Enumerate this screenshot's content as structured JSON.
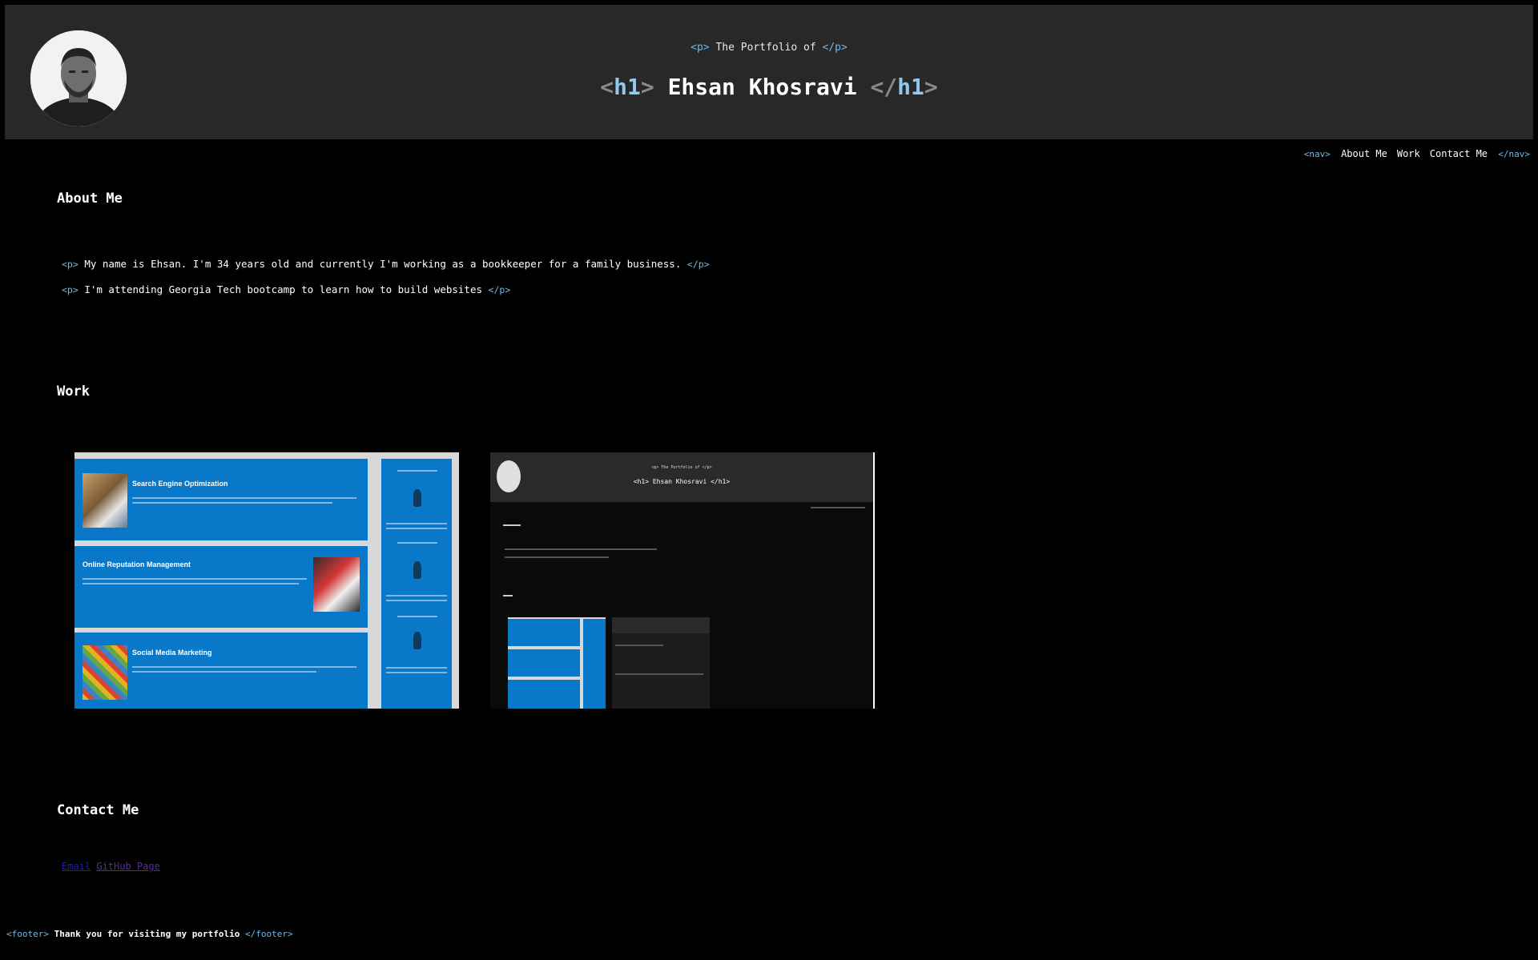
{
  "header": {
    "p_open": "<p>",
    "subtitle": "The Portfolio of",
    "p_close": "</p>",
    "h1_lt": "<",
    "h1_tag": "h1",
    "h1_gt": ">",
    "name": "Ehsan Khosravi",
    "h1_close_lt": "</",
    "h1_close_gt": ">"
  },
  "nav": {
    "open_tag": "<nav>",
    "items": [
      "About Me",
      "Work",
      "Contact Me"
    ],
    "close_tag": "</nav>"
  },
  "about": {
    "title": "About Me",
    "p_open": "<p>",
    "p_close": "</p>",
    "paragraphs": [
      "My name is Ehsan. I'm 34 years old and currently I'm working as a bookkeeper for a family business.",
      "I'm attending Georgia Tech bootcamp to learn how to build websites"
    ]
  },
  "work": {
    "title": "Work",
    "projects": [
      {
        "sections": [
          "Search Engine Optimization",
          "Online Reputation Management",
          "Social Media Marketing"
        ]
      },
      {
        "mini_subtitle": "<p> The Portfolio of </p>",
        "mini_title": "<h1> Ehsan Khosravi </h1>"
      }
    ]
  },
  "contact": {
    "title": "Contact Me",
    "links": [
      "Email",
      "GitHub Page"
    ]
  },
  "footer": {
    "open_tag": "<footer>",
    "text": "Thank you for visiting my portfolio",
    "close_tag": "</footer>"
  },
  "colors": {
    "background": "#000000",
    "header_bg": "#282828",
    "tag_color": "#6fb8e6",
    "link_unvisited": "#1a1ad4",
    "link_visited": "#5a2a9a"
  }
}
